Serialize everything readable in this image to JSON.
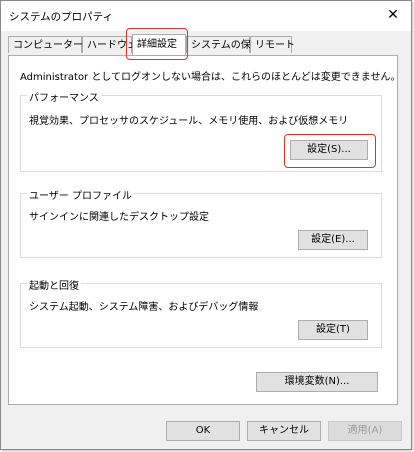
{
  "window": {
    "title": "システムのプロパティ",
    "close_glyph": "✕"
  },
  "tabs": [
    {
      "label": "コンピューター名"
    },
    {
      "label": "ハードウェア"
    },
    {
      "label": "詳細設定"
    },
    {
      "label": "システムの保護"
    },
    {
      "label": "リモート"
    }
  ],
  "notice": "Administrator としてログオンしない場合は、これらのほとんどは変更できません。",
  "performance": {
    "title": "パフォーマンス",
    "description": "視覚効果、プロセッサのスケジュール、メモリ使用、および仮想メモリ",
    "button": "設定(S)..."
  },
  "user_profile": {
    "title": "ユーザー プロファイル",
    "description": "サインインに関連したデスクトップ設定",
    "button": "設定(E)..."
  },
  "startup_recovery": {
    "title": "起動と回復",
    "description": "システム起動、システム障害、およびデバッグ情報",
    "button": "設定(T)"
  },
  "env_button": "環境変数(N)...",
  "footer": {
    "ok": "OK",
    "cancel": "キャンセル",
    "apply": "適用(A)"
  },
  "colors": {
    "highlight": "#e0322c",
    "panel": "#ffffff",
    "dialog_bg": "#f0f0f0"
  }
}
